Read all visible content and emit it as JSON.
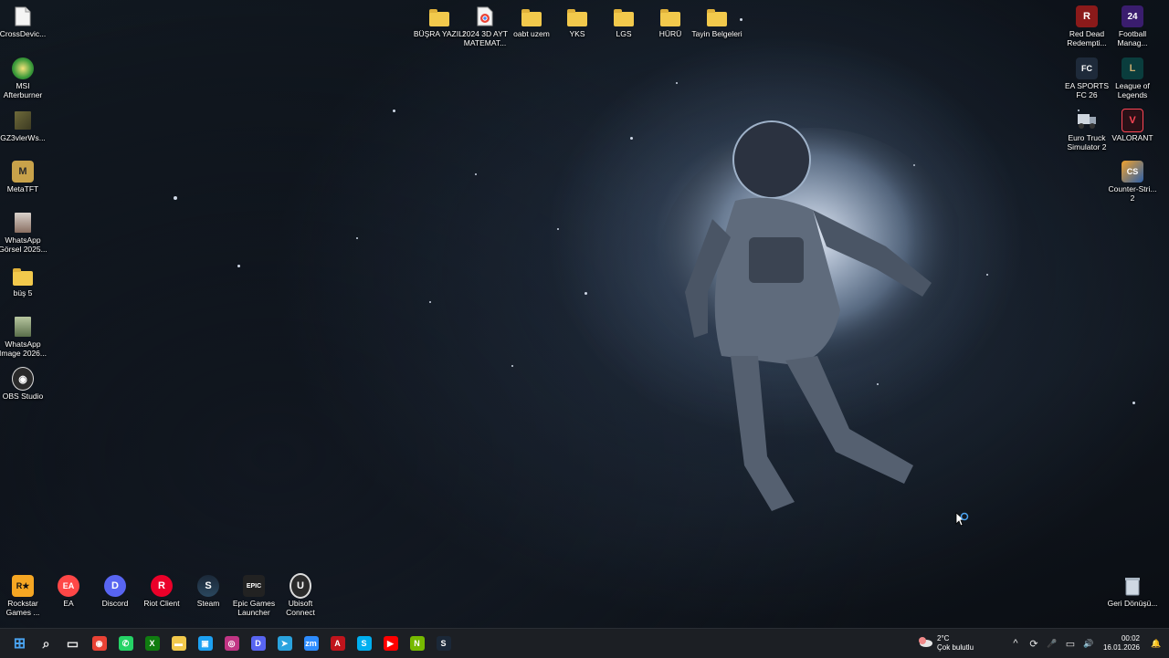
{
  "desktop": {
    "left_column": [
      {
        "label": "CrossDevic...",
        "icon": "file-icon"
      },
      {
        "label": "MSI Afterburner",
        "icon": "msi-afterburner-icon"
      },
      {
        "label": "GZ3vlerWs...",
        "icon": "image-icon"
      },
      {
        "label": "MetaTFT",
        "icon": "metatft-icon"
      },
      {
        "label": "WhatsApp Görsel 2025...",
        "icon": "photo-icon"
      },
      {
        "label": "büş 5",
        "icon": "folder-icon"
      },
      {
        "label": "WhatsApp Image 2026...",
        "icon": "photo-icon"
      },
      {
        "label": "OBS Studio",
        "icon": "obs-icon"
      }
    ],
    "top_row": [
      {
        "label": "BÜŞRA YAZILI",
        "icon": "folder-icon"
      },
      {
        "label": "2024 3D AYT MATEMAT...",
        "icon": "chrome-pdf-icon"
      },
      {
        "label": "oabt uzem",
        "icon": "folder-icon"
      },
      {
        "label": "YKS",
        "icon": "folder-icon"
      },
      {
        "label": "LGS",
        "icon": "folder-icon"
      },
      {
        "label": "HÜRÜ",
        "icon": "folder-icon"
      },
      {
        "label": "Tayin Belgeleri",
        "icon": "folder-icon"
      }
    ],
    "right_col_a": [
      {
        "label": "Red Dead Redempti...",
        "icon": "rdr-icon"
      },
      {
        "label": "EA SPORTS FC 26",
        "icon": "ea-fc-icon"
      },
      {
        "label": "Euro Truck Simulator 2",
        "icon": "truck-icon"
      }
    ],
    "right_col_b": [
      {
        "label": "Football Manag...",
        "icon": "fm-icon"
      },
      {
        "label": "League of Legends",
        "icon": "lol-icon"
      },
      {
        "label": "VALORANT",
        "icon": "valorant-icon"
      },
      {
        "label": "Counter-Stri... 2",
        "icon": "cs2-icon"
      }
    ],
    "bottom_row": [
      {
        "label": "Rockstar Games ...",
        "icon": "rockstar-icon"
      },
      {
        "label": "EA",
        "icon": "ea-icon"
      },
      {
        "label": "Discord",
        "icon": "discord-icon"
      },
      {
        "label": "Riot Client",
        "icon": "riot-icon"
      },
      {
        "label": "Steam",
        "icon": "steam-icon"
      },
      {
        "label": "Epic Games Launcher",
        "icon": "epic-icon"
      },
      {
        "label": "Ubisoft Connect",
        "icon": "ubisoft-icon"
      }
    ],
    "recycle_bin": {
      "label": "Geri Dönüşü...",
      "icon": "recycle-bin-icon"
    },
    "icon_text": {
      "rdr": "R",
      "fm": "24",
      "ea_fc": "FC",
      "lol": "L",
      "valorant": "V",
      "cs2": "CS",
      "rockstar": "R★",
      "ea": "EA",
      "discord": "D",
      "riot": "R",
      "steam": "S",
      "epic": "EPIC",
      "ubisoft": "U",
      "metatft": "M",
      "obs": "◉"
    }
  },
  "taskbar": {
    "apps": [
      {
        "name": "start-button",
        "glyph": "⊞",
        "color": "#4aa3f0"
      },
      {
        "name": "search-icon",
        "glyph": "⌕",
        "color": "#e8e8e8"
      },
      {
        "name": "task-view-icon",
        "glyph": "▭",
        "color": "#e8e8e8"
      },
      {
        "name": "chrome-icon",
        "glyph": "◉",
        "color": "#e94235"
      },
      {
        "name": "whatsapp-icon",
        "glyph": "✆",
        "color": "#25d366"
      },
      {
        "name": "xbox-icon",
        "glyph": "X",
        "color": "#107c10"
      },
      {
        "name": "file-explorer-icon",
        "glyph": "▬",
        "color": "#f2c94c"
      },
      {
        "name": "store-icon",
        "glyph": "▣",
        "color": "#1da1f2"
      },
      {
        "name": "instagram-icon",
        "glyph": "◎",
        "color": "#c13584"
      },
      {
        "name": "discord-taskbar-icon",
        "glyph": "D",
        "color": "#5865f2"
      },
      {
        "name": "telegram-icon",
        "glyph": "➤",
        "color": "#2aa3df"
      },
      {
        "name": "zoom-icon",
        "glyph": "zm",
        "color": "#2d8cff"
      },
      {
        "name": "acrobat-icon",
        "glyph": "A",
        "color": "#c0141c"
      },
      {
        "name": "skype-icon",
        "glyph": "S",
        "color": "#00aff0"
      },
      {
        "name": "youtube-icon",
        "glyph": "▶",
        "color": "#ff0000"
      },
      {
        "name": "nvidia-icon",
        "glyph": "N",
        "color": "#76b900"
      },
      {
        "name": "steam-taskbar-icon",
        "glyph": "S",
        "color": "#1b2838"
      }
    ],
    "weather": {
      "temp": "2°C",
      "desc": "Çok bulutlu"
    },
    "tray": {
      "chevron": "^",
      "sync": "⟳",
      "mic": "🎤",
      "network": "▭",
      "volume": "🔊"
    },
    "clock": {
      "time": "00:02",
      "date": "16.01.2026"
    },
    "notification": "🔔"
  }
}
